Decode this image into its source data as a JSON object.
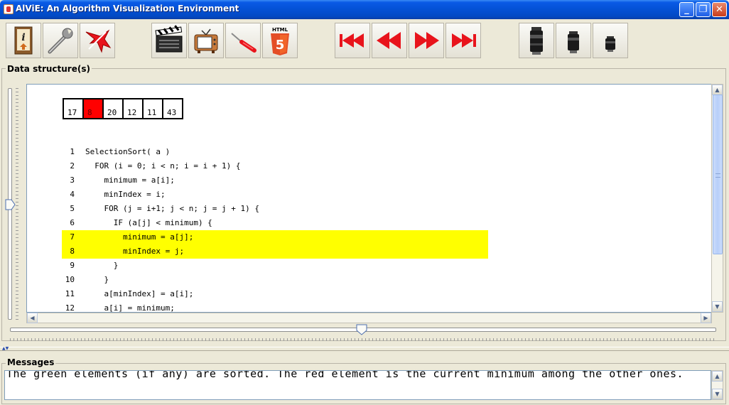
{
  "window": {
    "title": "AlViE: An Algorithm Visualization Environment",
    "minimize_glyph": "_",
    "maximize_glyph": "❐",
    "close_glyph": "✕"
  },
  "toolbar": {
    "groups": [
      [
        "info-icon",
        "wrench-icon",
        "tools-icon"
      ],
      [
        "clapperboard-icon",
        "tv-icon",
        "screwdriver-icon",
        "html5-icon"
      ],
      [
        "first-step-icon",
        "step-back-icon",
        "step-forward-icon",
        "last-step-icon"
      ],
      [
        "zoom-lens-large-icon",
        "zoom-lens-medium-icon",
        "zoom-lens-small-icon"
      ]
    ],
    "html5_label": "HTML",
    "html5_digit": "5",
    "accent_red": "#e8141c"
  },
  "data_structures": {
    "legend": "Data structure(s)",
    "array": [
      {
        "value": "17",
        "state": "normal"
      },
      {
        "value": "8",
        "state": "current-minimum"
      },
      {
        "value": "20",
        "state": "normal"
      },
      {
        "value": "12",
        "state": "normal"
      },
      {
        "value": "11",
        "state": "normal"
      },
      {
        "value": "43",
        "state": "normal"
      }
    ],
    "current_color": "#ff0000",
    "highlight_color": "#ffff00",
    "code": [
      {
        "num": "1",
        "text": "SelectionSort( a )",
        "highlight": false
      },
      {
        "num": "2",
        "text": "  FOR (i = 0; i < n; i = i + 1) {",
        "highlight": false
      },
      {
        "num": "3",
        "text": "    minimum = a[i];",
        "highlight": false
      },
      {
        "num": "4",
        "text": "    minIndex = i;",
        "highlight": false
      },
      {
        "num": "5",
        "text": "    FOR (j = i+1; j < n; j = j + 1) {",
        "highlight": false
      },
      {
        "num": "6",
        "text": "      IF (a[j] < minimum) {",
        "highlight": false
      },
      {
        "num": "7",
        "text": "        minimum = a[j];",
        "highlight": true
      },
      {
        "num": "8",
        "text": "        minIndex = j;",
        "highlight": true
      },
      {
        "num": "9",
        "text": "      }",
        "highlight": false
      },
      {
        "num": "10",
        "text": "    }",
        "highlight": false
      },
      {
        "num": "11",
        "text": "    a[minIndex] = a[i];",
        "highlight": false
      },
      {
        "num": "12",
        "text": "    a[i] = minimum;",
        "highlight": false
      }
    ]
  },
  "messages": {
    "legend": "Messages",
    "text": "The green elements (if any) are sorted. The red element is the current minimum among the other ones."
  }
}
